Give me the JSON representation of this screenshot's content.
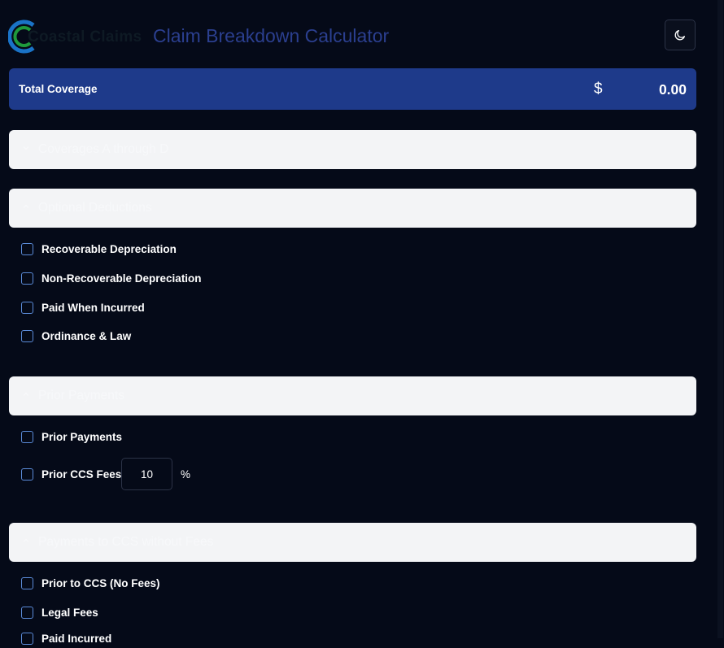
{
  "header": {
    "logo_text": "Coastal Claims",
    "title": "Claim Breakdown Calculator",
    "theme_toggle_icon": "moon-icon"
  },
  "total": {
    "label": "Total Coverage",
    "currency": "$",
    "amount": "0.00"
  },
  "sections": [
    {
      "title": "Coverages A through D",
      "chevron": "chevron-down-icon",
      "items": []
    },
    {
      "title": "Optional Deductions",
      "chevron": "chevron-up-icon",
      "items": [
        "Recoverable Depreciation",
        "Non-Recoverable Depreciation",
        "Paid When Incurred",
        "Ordinance & Law"
      ]
    },
    {
      "title": "Prior Payments",
      "chevron": "chevron-up-icon",
      "items": [
        "Prior Payments",
        "Prior CCS Fees"
      ],
      "fee_input": {
        "value": "10",
        "unit": "%"
      }
    },
    {
      "title": "Payments to CCS without Fees",
      "chevron": "chevron-up-icon",
      "items": [
        "Prior to CCS (No Fees)",
        "Legal Fees",
        "Paid Incurred"
      ]
    }
  ],
  "colors": {
    "background": "#050a18",
    "accent": "#1e3a8a",
    "title": "#2b3f8f",
    "section_header": "#f3f4f6",
    "checkbox_border": "#5b8bd8"
  }
}
